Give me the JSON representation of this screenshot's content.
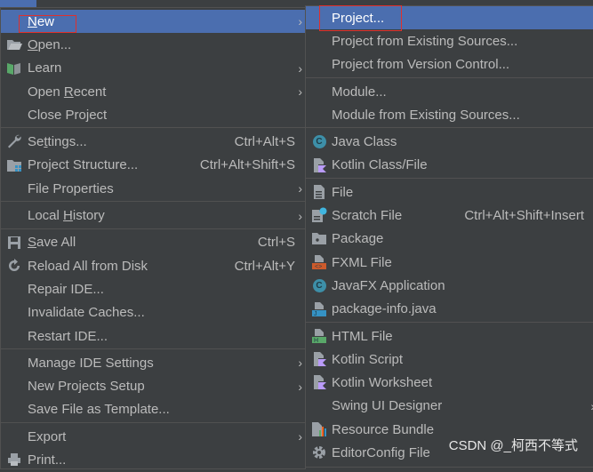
{
  "left_menu": [
    {
      "label": "New",
      "u": "N",
      "rest": "ew",
      "arrow": true,
      "selected": true,
      "icon": ""
    },
    {
      "label": "Open...",
      "u": "O",
      "rest": "pen...",
      "icon": "folder-open-icon"
    },
    {
      "label": "Learn",
      "arrow": true,
      "icon": "book-icon"
    },
    {
      "label": "Open Recent",
      "pre": "Open ",
      "u": "R",
      "rest": "ecent",
      "arrow": true
    },
    {
      "label": "Close Project"
    },
    "sep",
    {
      "label": "Settings...",
      "pre": "Se",
      "u": "t",
      "rest": "tings...",
      "shortcut": "Ctrl+Alt+S",
      "icon": "wrench-icon"
    },
    {
      "label": "Project Structure...",
      "shortcut": "Ctrl+Alt+Shift+S",
      "icon": "project-structure-icon"
    },
    {
      "label": "File Properties",
      "arrow": true
    },
    "sep",
    {
      "label": "Local History",
      "pre": "Local ",
      "u": "H",
      "rest": "istory",
      "arrow": true
    },
    "sep",
    {
      "label": "Save All",
      "u": "S",
      "rest": "ave All",
      "shortcut": "Ctrl+S",
      "icon": "save-icon"
    },
    {
      "label": "Reload All from Disk",
      "shortcut": "Ctrl+Alt+Y",
      "icon": "reload-icon"
    },
    {
      "label": "Repair IDE..."
    },
    {
      "label": "Invalidate Caches..."
    },
    {
      "label": "Restart IDE..."
    },
    "sep",
    {
      "label": "Manage IDE Settings",
      "arrow": true
    },
    {
      "label": "New Projects Setup",
      "arrow": true
    },
    {
      "label": "Save File as Template..."
    },
    "sep",
    {
      "label": "Export",
      "arrow": true
    },
    {
      "label": "Print...",
      "icon": "print-icon"
    }
  ],
  "right_menu": [
    {
      "label": "Project...",
      "selected": true
    },
    {
      "label": "Project from Existing Sources..."
    },
    {
      "label": "Project from Version Control..."
    },
    "sep",
    {
      "label": "Module..."
    },
    {
      "label": "Module from Existing Sources..."
    },
    "sep",
    {
      "label": "Java Class",
      "icon": "java-class-icon"
    },
    {
      "label": "Kotlin Class/File",
      "icon": "kotlin-file-icon"
    },
    "sep",
    {
      "label": "File",
      "icon": "file-icon"
    },
    {
      "label": "Scratch File",
      "shortcut": "Ctrl+Alt+Shift+Insert",
      "icon": "scratch-file-icon"
    },
    {
      "label": "Package",
      "icon": "package-icon"
    },
    {
      "label": "FXML File",
      "icon": "fxml-file-icon"
    },
    {
      "label": "JavaFX Application",
      "icon": "java-class-icon"
    },
    {
      "label": "package-info.java",
      "icon": "java-file-icon"
    },
    "sep",
    {
      "label": "HTML File",
      "icon": "html-file-icon"
    },
    {
      "label": "Kotlin Script",
      "icon": "kotlin-file-icon"
    },
    {
      "label": "Kotlin Worksheet",
      "icon": "kotlin-file-icon"
    },
    {
      "label": "Swing UI Designer",
      "arrow": true
    },
    {
      "label": "Resource Bundle",
      "icon": "resource-bundle-icon"
    },
    {
      "label": "EditorConfig File",
      "icon": "gear-icon"
    }
  ],
  "watermark": "CSDN @_柯西不等式",
  "colors": {
    "background": "#3c3f41",
    "selection": "#4b6eaf",
    "highlight_box": "#e0302c"
  }
}
